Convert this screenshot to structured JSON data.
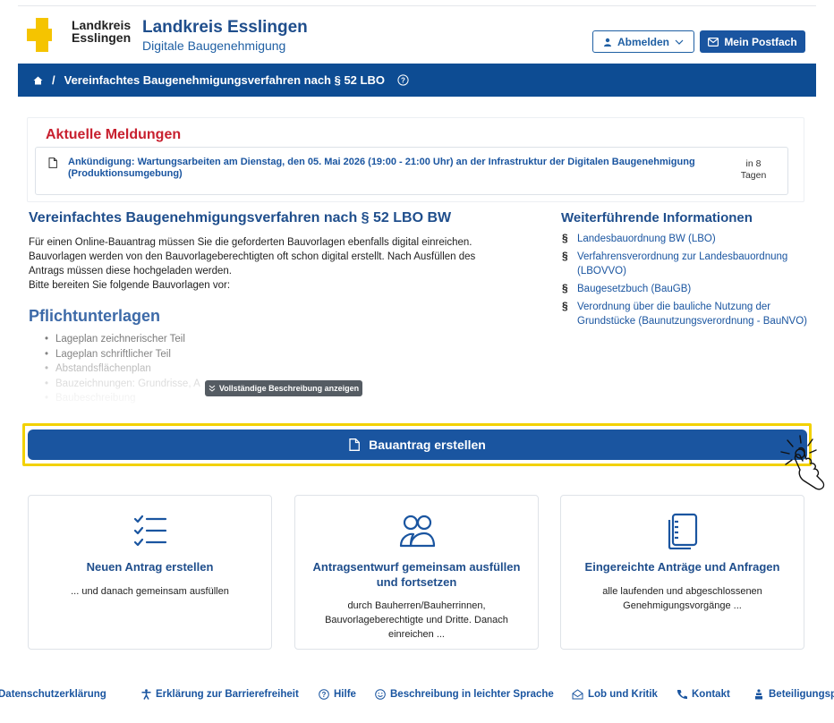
{
  "header": {
    "logo_line1": "Landkreis",
    "logo_line2": "Esslingen",
    "title": "Landkreis Esslingen",
    "subtitle": "Digitale Baugenehmigung",
    "logout_label": "Abmelden",
    "mailbox_label": "Mein Postfach"
  },
  "breadcrumb": {
    "separator": "/",
    "current": "Vereinfachtes Baugenehmigungsverfahren nach § 52 LBO"
  },
  "news": {
    "title": "Aktuelle Meldungen",
    "item_text": "Ankündigung: Wartungsarbeiten am Dienstag, den 05. Mai 2026 (19:00 - 21:00 Uhr) an der Infrastruktur der Digitalen Baugenehmigung (Produktionsumgebung)",
    "item_when": "in 8 Tagen"
  },
  "main": {
    "title": "Vereinfachtes Baugenehmigungsverfahren nach § 52 LBO BW",
    "desc_line1": "Für einen Online-Bauantrag müssen Sie die geforderten Bauvorlagen ebenfalls digital einreichen.",
    "desc_line2": "Bauvorlagen werden von den Bauvorlageberechtigten oft schon digital erstellt. Nach Ausfüllen des",
    "desc_line3": "Antrags müssen diese hochgeladen werden.",
    "desc_line4": "Bitte bereiten Sie folgende Bauvorlagen vor:",
    "required_title": "Pflichtunterlagen",
    "required_items": [
      "Lageplan zeichnerischer Teil",
      "Lageplan schriftlicher Teil",
      "Abstandsflächenplan",
      "Bauzeichnungen: Grundrisse, A",
      "Baubeschreibung"
    ],
    "show_more_label": "Vollständige Beschreibung anzeigen"
  },
  "sidebar": {
    "title": "Weiterführende Informationen",
    "symbol": "§",
    "links": [
      "Landesbauordnung BW (LBO)",
      "Verfahrensverordnung zur Landesbauordnung (LBOVVO)",
      "Baugesetzbuch (BauGB)",
      "Verordnung über die bauliche Nutzung der Grundstücke (Baunutzungsverordnung - BauNVO)"
    ]
  },
  "cta": {
    "label": "Bauantrag erstellen"
  },
  "cards": [
    {
      "title": "Neuen Antrag erstellen",
      "desc": "... und danach gemeinsam ausfüllen"
    },
    {
      "title_line1": "Antragsentwurf gemeinsam ausfüllen",
      "title_line2": "und fortsetzen",
      "desc_line1": "durch Bauherren/Bauherrinnen,",
      "desc_line2": "Bauvorlageberechtigte und Dritte. Danach",
      "desc_line3": "einreichen ..."
    },
    {
      "title": "Eingereichte Anträge und Anfragen",
      "desc_line1": "alle laufenden und abgeschlossenen",
      "desc_line2": "Genehmigungsvorgänge ..."
    }
  ],
  "footer": {
    "privacy": "Datenschutzerklärung",
    "accessibility": "Erklärung zur Barrierefreiheit",
    "help": "Hilfe",
    "easy_language": "Beschreibung in leichter Sprache",
    "feedback": "Lob und Kritik",
    "contact": "Kontakt",
    "participation": "Beteiligungsportal"
  },
  "colors": {
    "primary": "#1a55a0",
    "nav_bar": "#0d4c93",
    "news_title": "#c8202f",
    "highlight": "#f2d100",
    "logo_yellow": "#f5c400"
  }
}
